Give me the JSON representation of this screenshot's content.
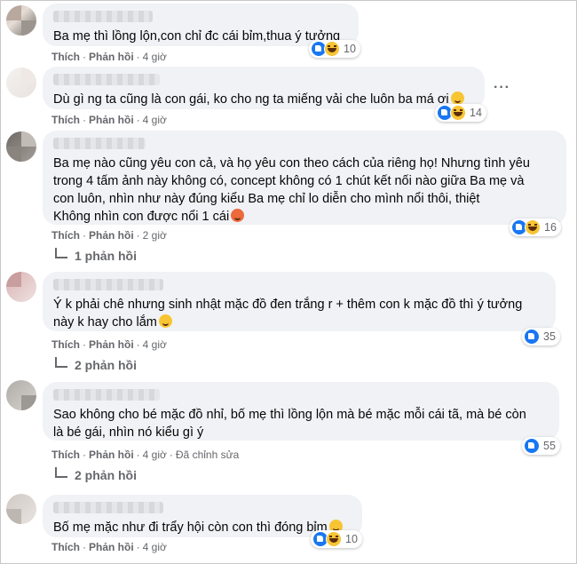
{
  "actions": {
    "like": "Thích",
    "reply": "Phản hồi",
    "dot": "·"
  },
  "comments": [
    {
      "text": "Ba mẹ thì lồng lộn,con chỉ đc cái bỉm,thua ý tưởng",
      "reactions": "10",
      "time": "4 giờ"
    },
    {
      "text": "Dù gì ng ta cũng là con gái, ko cho ng ta miếng vải che luôn ba má ơi",
      "reactions": "14",
      "time": "4 giờ",
      "more": "···"
    },
    {
      "text": "Ba mẹ nào cũng yêu con cả, và họ yêu con theo cách của riêng họ! Nhưng tình yêu\ntrong 4 tấm ảnh này không có, concept không có 1 chút kết nối nào giữa Ba mẹ và\ncon luôn, nhìn như này đúng kiểu Ba mẹ chỉ lo diễn cho mình nổi thôi, thiệt\nKhông nhìn con được nổi 1 cái",
      "reactions": "16",
      "time": "2 giờ",
      "replies": "1 phản hồi"
    },
    {
      "text": "Ý k phải chê nhưng sinh nhật mặc đồ đen trắng r + thêm con k mặc đồ thì ý tưởng\nnày k hay cho lắm",
      "reactions": "35",
      "time": "4 giờ",
      "replies": "2 phản hồi"
    },
    {
      "text": "Sao không cho bé mặc đồ nhỉ, bố mẹ thì lồng lộn mà bé mặc mỗi cái tã, mà bé còn\nlà bé gái, nhìn nó kiểu gì ý",
      "reactions": "55",
      "time": "4 giờ",
      "edited": "Đã chỉnh sửa",
      "replies": "2 phản hồi"
    },
    {
      "text": "Bố mẹ mặc như đi trẩy hội còn con thì đóng bỉm",
      "reactions": "10",
      "time": "4 giờ"
    }
  ],
  "icons": {
    "like": "like-reaction-icon",
    "haha": "haha-reaction-icon",
    "reply_arrow": "reply-arrow-icon",
    "avatar": "avatar-pixelated"
  },
  "colors": {
    "bubble": "#f0f2f5",
    "meta": "#65676b",
    "like_blue": "#1877f2"
  }
}
